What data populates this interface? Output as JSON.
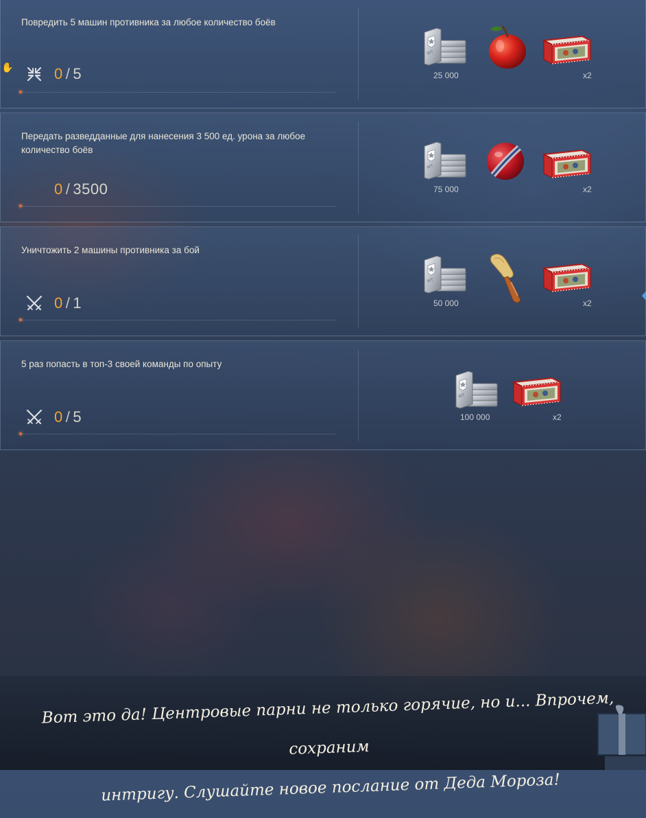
{
  "tasks": [
    {
      "description": "Повредить 5 машин противника за любое количество боёв",
      "progress_current": "0",
      "progress_sep": "/",
      "progress_total": "5",
      "icon": "damage-icon",
      "rewards": [
        {
          "type": "credits-icon",
          "label": "25 000"
        },
        {
          "type": "apple-icon",
          "label": ""
        },
        {
          "type": "crate-icon",
          "label": "x2"
        }
      ]
    },
    {
      "description": "Передать разведданные для нанесения 3 500 ед. урона за любое количество боёв",
      "progress_current": "0",
      "progress_sep": "/",
      "progress_total": "3500",
      "icon": "",
      "rewards": [
        {
          "type": "credits-icon",
          "label": "75 000"
        },
        {
          "type": "ball-icon",
          "label": ""
        },
        {
          "type": "crate-icon",
          "label": "x2"
        }
      ]
    },
    {
      "description": "Уничтожить 2 машины противника за бой",
      "progress_current": "0",
      "progress_sep": "/",
      "progress_total": "1",
      "icon": "crossed-swords-icon",
      "rewards": [
        {
          "type": "credits-icon",
          "label": "50 000"
        },
        {
          "type": "brush-icon",
          "label": ""
        },
        {
          "type": "crate-icon",
          "label": "x2"
        }
      ]
    },
    {
      "description": "5 раз попасть в топ-3 своей команды по опыту",
      "progress_current": "0",
      "progress_sep": "/",
      "progress_total": "5",
      "icon": "crossed-swords-icon",
      "rewards": [
        {
          "type": "credits-icon",
          "label": "100 000"
        },
        {
          "type": "crate-icon",
          "label": "x2"
        }
      ]
    }
  ],
  "message": {
    "line1": "Вот это да! Центровые парни не только горячие, но и... Впрочем, сохраним",
    "line2": "интригу. Слушайте новое послание от Деда Мороза!"
  },
  "colors": {
    "progress_current": "#f0a335",
    "text": "#e9e5d6",
    "accent_dot": "#e0703a"
  }
}
